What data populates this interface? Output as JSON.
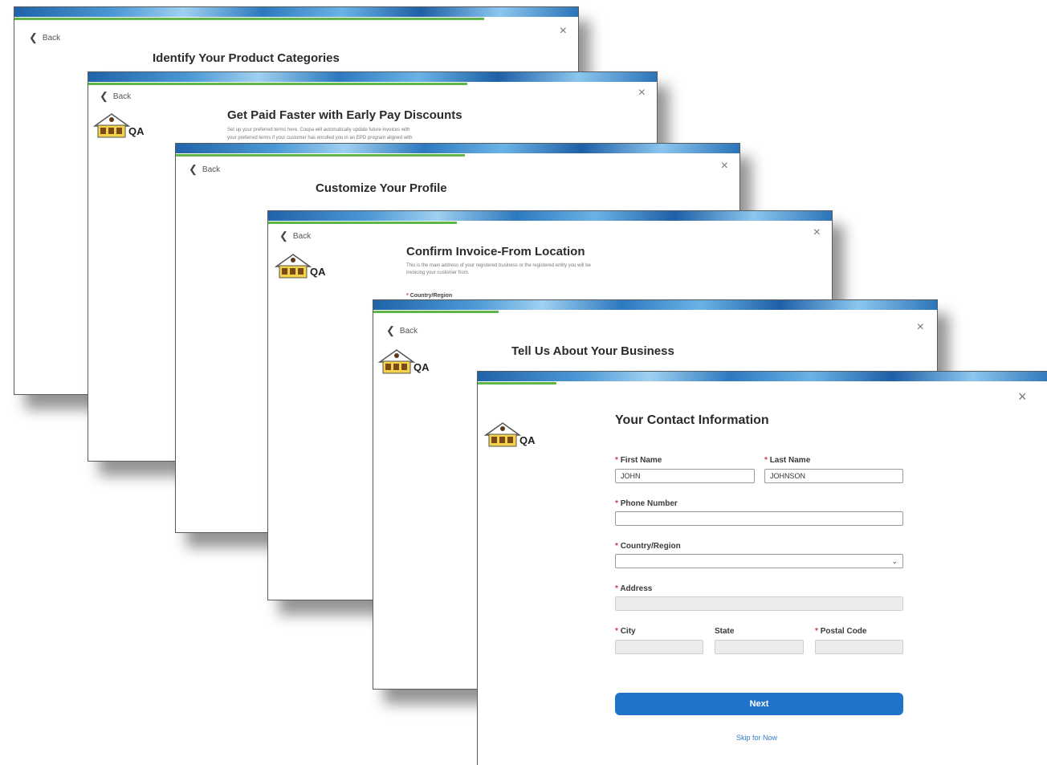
{
  "back_label": "Back",
  "close_glyph": "×",
  "back_glyph": "❮",
  "logo_text": "QA",
  "required_mark": "*",
  "screens": [
    {
      "title": "Identify Your Product Categories"
    },
    {
      "title": "Get Paid Faster with Early Pay Discounts",
      "description_1": "Set up your preferred terms here. Coupa will automatically update future invoices with",
      "description_2": "your preferred terms if your customer has enrolled you in an EPD program aligned with"
    },
    {
      "title": "Customize Your Profile"
    },
    {
      "title": "Confirm Invoice-From Location",
      "description_1": "This is the main address of your registered business or the registered entity you will be",
      "description_2": "invoicing your customer from.",
      "country_label": "Country/Region"
    },
    {
      "title": "Tell Us About Your Business"
    }
  ],
  "contact_form": {
    "title": "Your Contact Information",
    "first_name_label": "First Name",
    "first_name_value": "JOHN",
    "last_name_label": "Last Name",
    "last_name_value": "JOHNSON",
    "phone_label": "Phone Number",
    "phone_value": "",
    "country_label": "Country/Region",
    "country_value": "",
    "address_label": "Address",
    "city_label": "City",
    "state_label": "State",
    "postal_label": "Postal Code",
    "next_label": "Next",
    "skip_label": "Skip for Now"
  },
  "colors": {
    "primary_button": "#1f73c9",
    "progress_green": "#5fb646",
    "banner_blue": "#2d79bf",
    "required_red": "#d23b3b",
    "link_blue": "#2f7cc8"
  },
  "icons": [
    "back-chevron-icon",
    "close-icon",
    "chevron-down-icon",
    "company-logo-icon"
  ]
}
